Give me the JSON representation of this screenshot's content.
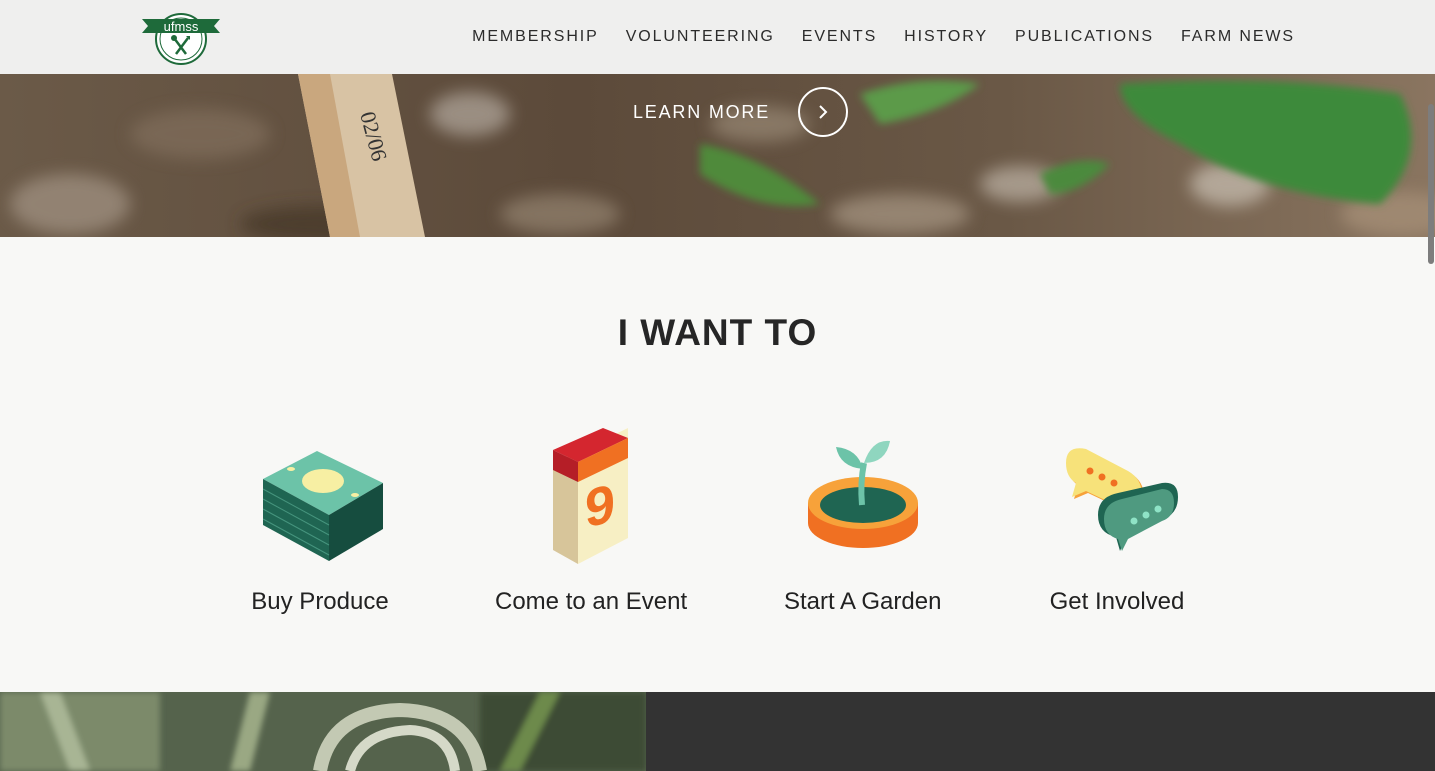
{
  "header": {
    "logo_text": "ufmss",
    "nav": [
      {
        "label": "MEMBERSHIP"
      },
      {
        "label": "VOLUNTEERING"
      },
      {
        "label": "EVENTS"
      },
      {
        "label": "HISTORY"
      },
      {
        "label": "PUBLICATIONS"
      },
      {
        "label": "FARM NEWS"
      }
    ]
  },
  "hero": {
    "learn_more": "LEARN MORE",
    "stake_text": "02/06"
  },
  "want": {
    "title": "I WANT TO",
    "options": [
      {
        "label": "Buy Produce",
        "icon": "money-stack-icon"
      },
      {
        "label": "Come to an Event",
        "icon": "calendar-icon"
      },
      {
        "label": "Start A Garden",
        "icon": "sprout-pot-icon"
      },
      {
        "label": "Get Involved",
        "icon": "chat-bubbles-icon"
      }
    ],
    "calendar_day": "9"
  },
  "colors": {
    "brand_green": "#1e6a3a",
    "teal_dark": "#1f6552",
    "teal_light": "#6cc3a8",
    "orange": "#f07022",
    "red": "#d4262f",
    "yellow": "#f7e27a"
  }
}
